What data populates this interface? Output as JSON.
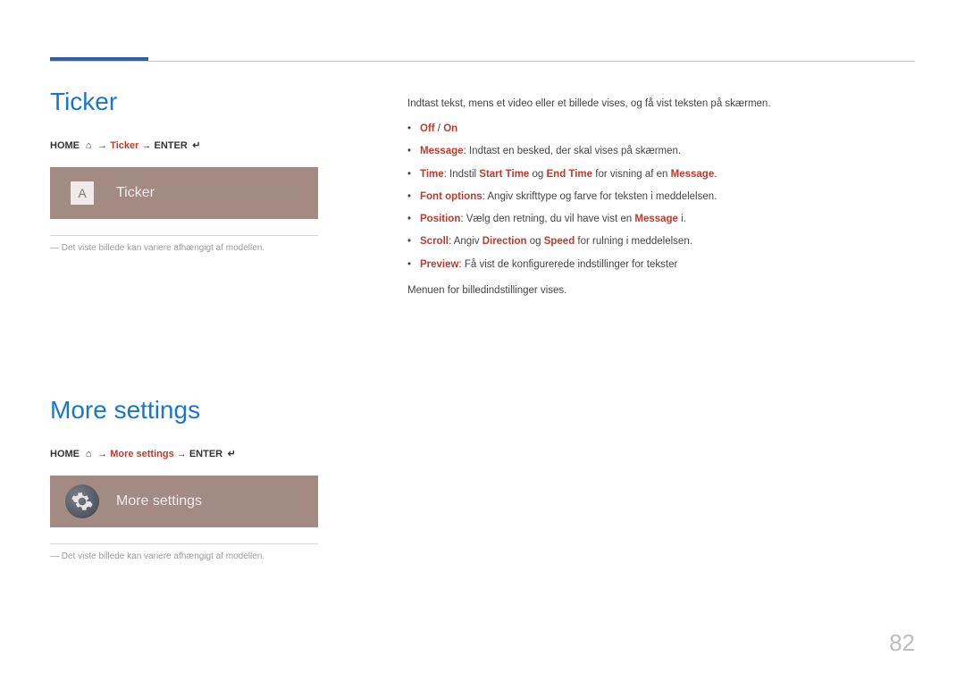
{
  "page_number": "82",
  "sections": {
    "ticker": {
      "title": "Ticker",
      "nav": {
        "home": "HOME",
        "home_icon": "⌂",
        "arrow": "→",
        "item": "Ticker",
        "enter": "ENTER",
        "enter_icon": "↵"
      },
      "tile": {
        "letter": "A",
        "label": "Ticker"
      },
      "footnote_prefix": "―",
      "footnote": "Det viste billede kan variere afhængigt af modellen.",
      "intro": "Indtast tekst, mens et video eller et billede vises, og få vist teksten på skærmen.",
      "bullets": [
        {
          "parts": [
            {
              "t": "Off",
              "c": "hl"
            },
            {
              "t": " / "
            },
            {
              "t": "On",
              "c": "hl"
            }
          ]
        },
        {
          "parts": [
            {
              "t": "Message",
              "c": "hl"
            },
            {
              "t": ": Indtast en besked, der skal vises på skærmen."
            }
          ]
        },
        {
          "parts": [
            {
              "t": "Time",
              "c": "hl"
            },
            {
              "t": ": Indstil "
            },
            {
              "t": "Start Time",
              "c": "hl"
            },
            {
              "t": " og "
            },
            {
              "t": "End Time",
              "c": "hl"
            },
            {
              "t": " for visning af en "
            },
            {
              "t": "Message",
              "c": "hl"
            },
            {
              "t": "."
            }
          ]
        },
        {
          "parts": [
            {
              "t": "Font options",
              "c": "hl"
            },
            {
              "t": ": Angiv skrifttype og farve for teksten i meddelelsen."
            }
          ]
        },
        {
          "parts": [
            {
              "t": "Position",
              "c": "hl"
            },
            {
              "t": ":  Vælg den retning, du vil have vist en "
            },
            {
              "t": "Message",
              "c": "hl"
            },
            {
              "t": " i."
            }
          ]
        },
        {
          "parts": [
            {
              "t": "Scroll",
              "c": "hl"
            },
            {
              "t": ": Angiv "
            },
            {
              "t": "Direction",
              "c": "hl"
            },
            {
              "t": " og "
            },
            {
              "t": "Speed",
              "c": "hl"
            },
            {
              "t": " for rulning i meddelelsen."
            }
          ]
        },
        {
          "parts": [
            {
              "t": "Preview",
              "c": "hl"
            },
            {
              "t": ": Få vist de konfigurerede indstillinger for tekster"
            }
          ]
        }
      ]
    },
    "more": {
      "title": "More settings",
      "nav": {
        "home": "HOME",
        "home_icon": "⌂",
        "arrow": "→",
        "item": "More settings",
        "enter": "ENTER",
        "enter_icon": "↵"
      },
      "tile": {
        "label": "More settings"
      },
      "footnote_prefix": "―",
      "footnote": "Det viste billede kan variere afhængigt af modellen.",
      "intro": "Menuen for billedindstillinger vises."
    }
  }
}
